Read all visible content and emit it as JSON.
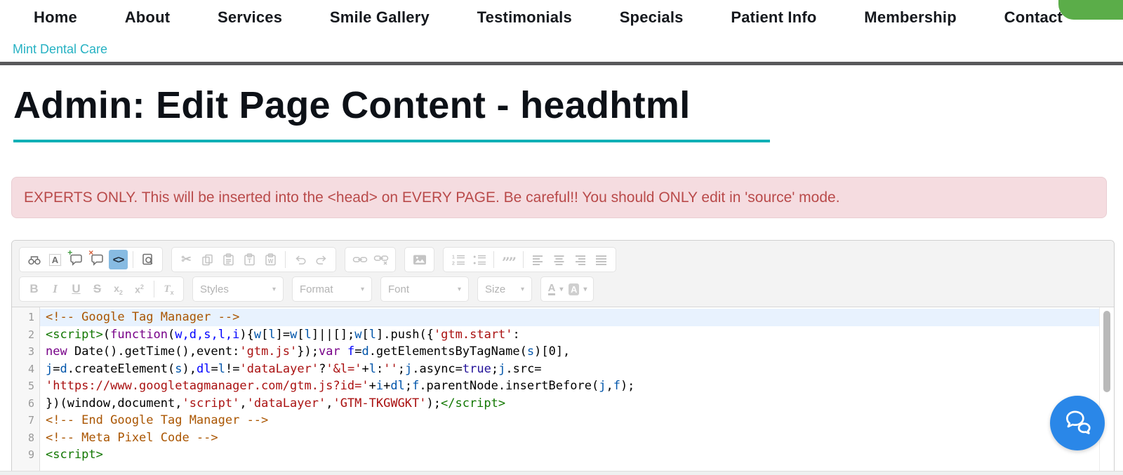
{
  "header": {
    "nav_items": [
      "Home",
      "About",
      "Services",
      "Smile Gallery",
      "Testimonials",
      "Specials",
      "Patient Info",
      "Membership",
      "Contact"
    ],
    "brand": "Mint Dental Care"
  },
  "page": {
    "title": "Admin: Edit Page Content - headhtml"
  },
  "warning": {
    "text": "EXPERTS ONLY. This will be inserted into the <head> on EVERY PAGE. Be careful!! You should ONLY edit in 'source' mode."
  },
  "colors": {
    "accent_teal": "#10b0b6",
    "brand_teal": "#27b2c3",
    "warning_text": "#b94a4a",
    "warning_bg": "#f5dce0",
    "source_button_active": "#87bbe2",
    "corner_button_green": "#5bad49",
    "chat_button_blue": "#2a87e8",
    "active_line_bg": "#e8f2fe"
  },
  "editor": {
    "active_button": "source",
    "toolbar": {
      "row1": [
        {
          "group": "document-tools",
          "items": [
            {
              "icon": "find",
              "enabled": true
            },
            {
              "icon": "replace",
              "enabled": true
            },
            {
              "icon": "accept-suggestion",
              "enabled": true
            },
            {
              "icon": "reject-suggestion",
              "enabled": true
            },
            {
              "icon": "source",
              "enabled": true,
              "active": true
            },
            {
              "sep": true
            },
            {
              "icon": "preview",
              "enabled": true
            }
          ]
        },
        {
          "group": "clipboard",
          "items": [
            {
              "icon": "cut"
            },
            {
              "icon": "copy"
            },
            {
              "icon": "paste"
            },
            {
              "icon": "paste-plain-text"
            },
            {
              "icon": "paste-from-word"
            },
            {
              "sep": true
            },
            {
              "icon": "undo"
            },
            {
              "icon": "redo"
            }
          ]
        },
        {
          "group": "links",
          "items": [
            {
              "icon": "link"
            },
            {
              "icon": "unlink"
            }
          ]
        },
        {
          "group": "insert",
          "items": [
            {
              "icon": "image"
            }
          ]
        },
        {
          "group": "paragraph",
          "items": [
            {
              "icon": "numbered-list"
            },
            {
              "icon": "bulleted-list"
            },
            {
              "sep": true
            },
            {
              "icon": "blockquote"
            },
            {
              "sep": true
            },
            {
              "icon": "align-left"
            },
            {
              "icon": "align-center"
            },
            {
              "icon": "align-right"
            },
            {
              "icon": "justify"
            }
          ]
        }
      ],
      "row2": [
        {
          "group": "basic-styles",
          "items": [
            {
              "icon": "bold"
            },
            {
              "icon": "italic"
            },
            {
              "icon": "underline"
            },
            {
              "icon": "strikethrough"
            },
            {
              "icon": "subscript"
            },
            {
              "icon": "superscript"
            },
            {
              "sep": true
            },
            {
              "icon": "remove-format"
            }
          ]
        },
        {
          "group": "styles-dropdown",
          "dropdown": "Styles"
        },
        {
          "group": "format-dropdown",
          "dropdown": "Format"
        },
        {
          "group": "font-dropdown",
          "dropdown": "Font"
        },
        {
          "group": "size-dropdown",
          "dropdown": "Size"
        },
        {
          "group": "colors",
          "items": [
            {
              "icon": "text-color"
            },
            {
              "icon": "background-color"
            }
          ]
        }
      ]
    },
    "code": {
      "lines": [
        {
          "n": "1",
          "active": true,
          "seg": [
            [
              "c",
              "<!-- Google Tag Manager -->"
            ]
          ]
        },
        {
          "n": "2",
          "seg": [
            [
              "t",
              "<script>"
            ],
            [
              "p",
              "("
            ],
            [
              "k",
              "function"
            ],
            [
              "p",
              "("
            ],
            [
              "d",
              "w,d,s,l,i"
            ],
            [
              "p",
              "){"
            ],
            [
              "v",
              "w"
            ],
            [
              "p",
              "["
            ],
            [
              "v",
              "l"
            ],
            [
              "p",
              "]="
            ],
            [
              "v",
              "w"
            ],
            [
              "p",
              "["
            ],
            [
              "v",
              "l"
            ],
            [
              "p",
              "]||[];"
            ],
            [
              "v",
              "w"
            ],
            [
              "p",
              "["
            ],
            [
              "v",
              "l"
            ],
            [
              "p",
              "].push({"
            ],
            [
              "s",
              "'gtm.start'"
            ],
            [
              "p",
              ":"
            ]
          ]
        },
        {
          "n": "3",
          "seg": [
            [
              "k",
              "new"
            ],
            [
              "p",
              " Date().getTime(),event:"
            ],
            [
              "s",
              "'gtm.js'"
            ],
            [
              "p",
              "});"
            ],
            [
              "k",
              "var"
            ],
            [
              "p",
              " "
            ],
            [
              "d",
              "f"
            ],
            [
              "p",
              "="
            ],
            [
              "v",
              "d"
            ],
            [
              "p",
              ".getElementsByTagName("
            ],
            [
              "v",
              "s"
            ],
            [
              "p",
              ")[0],"
            ]
          ]
        },
        {
          "n": "4",
          "seg": [
            [
              "v",
              "j"
            ],
            [
              "p",
              "="
            ],
            [
              "v",
              "d"
            ],
            [
              "p",
              ".createElement("
            ],
            [
              "v",
              "s"
            ],
            [
              "p",
              "),"
            ],
            [
              "d",
              "dl"
            ],
            [
              "p",
              "="
            ],
            [
              "v",
              "l"
            ],
            [
              "p",
              "!="
            ],
            [
              "s",
              "'dataLayer'"
            ],
            [
              "p",
              "?"
            ],
            [
              "s",
              "'&l='"
            ],
            [
              "p",
              "+"
            ],
            [
              "v",
              "l"
            ],
            [
              "p",
              ":"
            ],
            [
              "s",
              "''"
            ],
            [
              "p",
              ";"
            ],
            [
              "v",
              "j"
            ],
            [
              "p",
              ".async="
            ],
            [
              "a",
              "true"
            ],
            [
              "p",
              ";"
            ],
            [
              "v",
              "j"
            ],
            [
              "p",
              ".src="
            ]
          ]
        },
        {
          "n": "5",
          "seg": [
            [
              "s",
              "'https://www.googletagmanager.com/gtm.js?id='"
            ],
            [
              "p",
              "+"
            ],
            [
              "v",
              "i"
            ],
            [
              "p",
              "+"
            ],
            [
              "v",
              "dl"
            ],
            [
              "p",
              ";"
            ],
            [
              "v",
              "f"
            ],
            [
              "p",
              ".parentNode.insertBefore("
            ],
            [
              "v",
              "j"
            ],
            [
              "p",
              ","
            ],
            [
              "v",
              "f"
            ],
            [
              "p",
              ");"
            ]
          ]
        },
        {
          "n": "6",
          "seg": [
            [
              "p",
              "})(window,document,"
            ],
            [
              "s",
              "'script'"
            ],
            [
              "p",
              ","
            ],
            [
              "s",
              "'dataLayer'"
            ],
            [
              "p",
              ","
            ],
            [
              "s",
              "'GTM-TKGWGKT'"
            ],
            [
              "p",
              ");"
            ],
            [
              "t",
              "</script>"
            ]
          ]
        },
        {
          "n": "7",
          "seg": [
            [
              "c",
              "<!-- End Google Tag Manager -->"
            ]
          ]
        },
        {
          "n": "8",
          "seg": [
            [
              "c",
              "<!-- Meta Pixel Code -->"
            ]
          ]
        },
        {
          "n": "9",
          "seg": [
            [
              "t",
              "<script>"
            ]
          ]
        }
      ]
    }
  }
}
